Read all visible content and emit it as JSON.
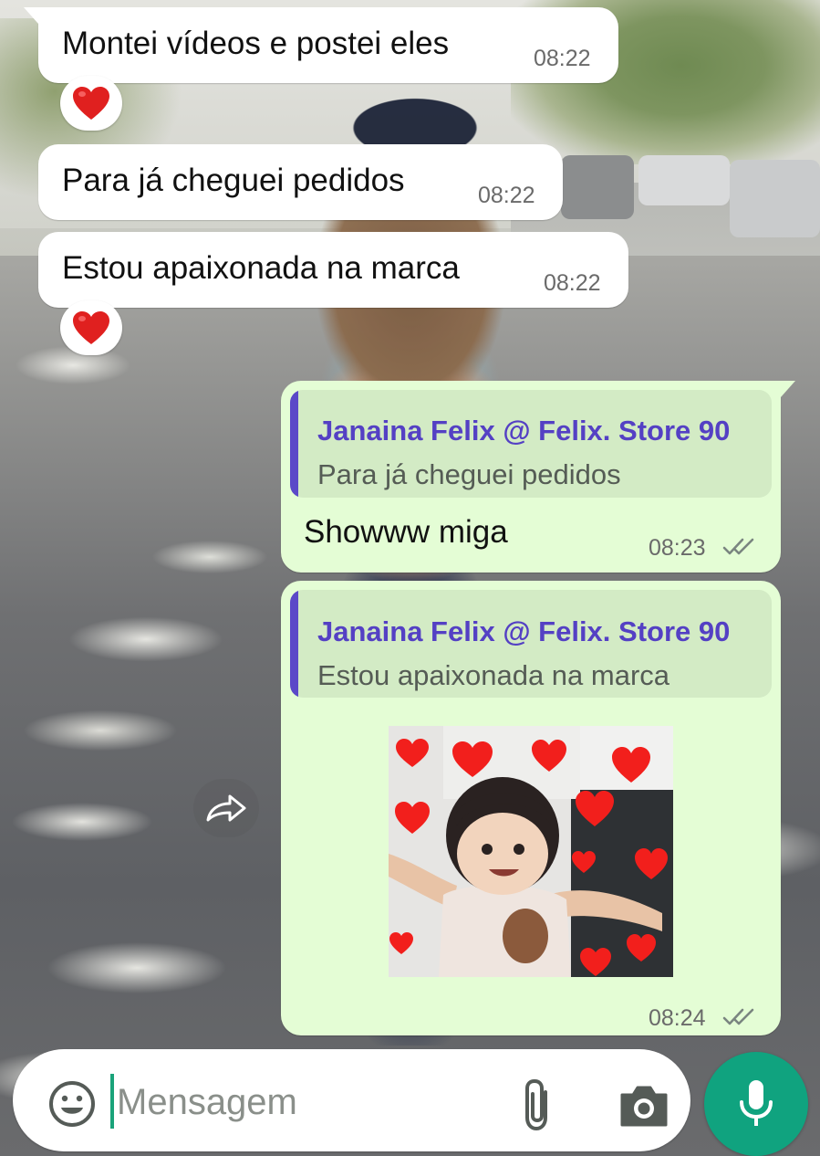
{
  "messages": [
    {
      "id": "m1",
      "direction": "incoming",
      "text": "Montei vídeos e postei eles",
      "time": "08:22",
      "reaction": "red-heart"
    },
    {
      "id": "m2",
      "direction": "incoming",
      "text": "Para já cheguei pedidos",
      "time": "08:22"
    },
    {
      "id": "m3",
      "direction": "incoming",
      "text": "Estou apaixonada na marca",
      "time": "08:22",
      "reaction": "red-heart"
    },
    {
      "id": "m4",
      "direction": "outgoing",
      "quote": {
        "author": "Janaina Felix @ Felix. Store 90",
        "text": "Para já cheguei pedidos"
      },
      "text": "Showww miga",
      "time": "08:23",
      "status": "double-check-read"
    },
    {
      "id": "m5",
      "direction": "outgoing",
      "quote": {
        "author": "Janaina Felix @ Felix. Store 90",
        "text": "Estou apaixonada na marca"
      },
      "type": "sticker",
      "sticker_icon": "girl-with-hearts-sticker",
      "time": "08:24",
      "status": "double-check-read"
    }
  ],
  "composer": {
    "placeholder": "Mensagem",
    "emoji_icon": "emoji-icon",
    "attach_icon": "paperclip-icon",
    "camera_icon": "camera-icon",
    "mic_icon": "microphone-icon"
  },
  "forward_icon": "forward-icon",
  "colors": {
    "incoming_bubble": "#ffffff",
    "outgoing_bubble": "#e4fdd5",
    "quote_author": "#5440c4",
    "quote_bar": "#5b49c8",
    "mic_button": "#10a37f",
    "heart": "#e0201f"
  }
}
